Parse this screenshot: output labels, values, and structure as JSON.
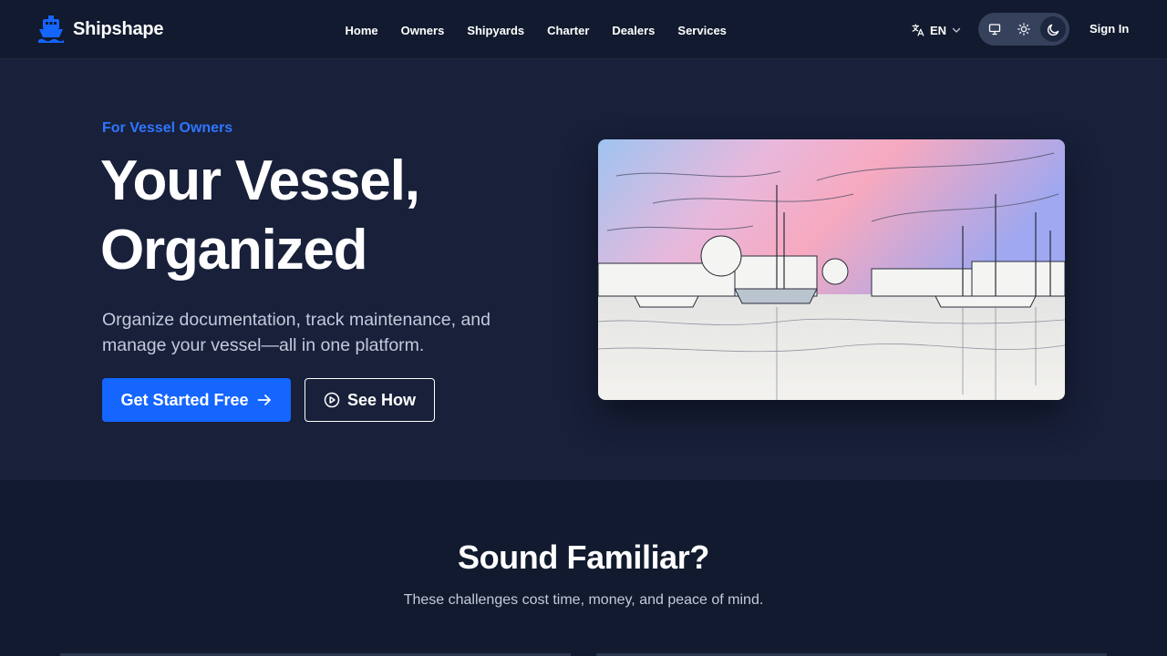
{
  "brand": {
    "name": "Shipshape",
    "color": "#1565ff"
  },
  "nav": {
    "items": [
      "Home",
      "Owners",
      "Shipyards",
      "Charter",
      "Dealers",
      "Services"
    ]
  },
  "header": {
    "language": {
      "icon": "translate-icon",
      "label": "EN"
    },
    "theme": {
      "options": [
        "system",
        "light",
        "dark"
      ],
      "selected": "dark"
    },
    "signin_label": "Sign In"
  },
  "hero": {
    "eyebrow": "For Vessel Owners",
    "title_line1": "Your Vessel,",
    "title_line2": "Organized",
    "subtitle": "Organize documentation, track maintenance, and manage your vessel—all in one platform.",
    "primary_cta": "Get Started Free",
    "secondary_cta": "See How"
  },
  "pain": {
    "title": "Sound Familiar?",
    "subtitle": "These challenges cost time, money, and peace of mind."
  },
  "colors": {
    "accent": "#1565ff",
    "eyebrow": "#2f76ff",
    "hero_bg": "#18203a",
    "page_bg": "#111a2e"
  }
}
